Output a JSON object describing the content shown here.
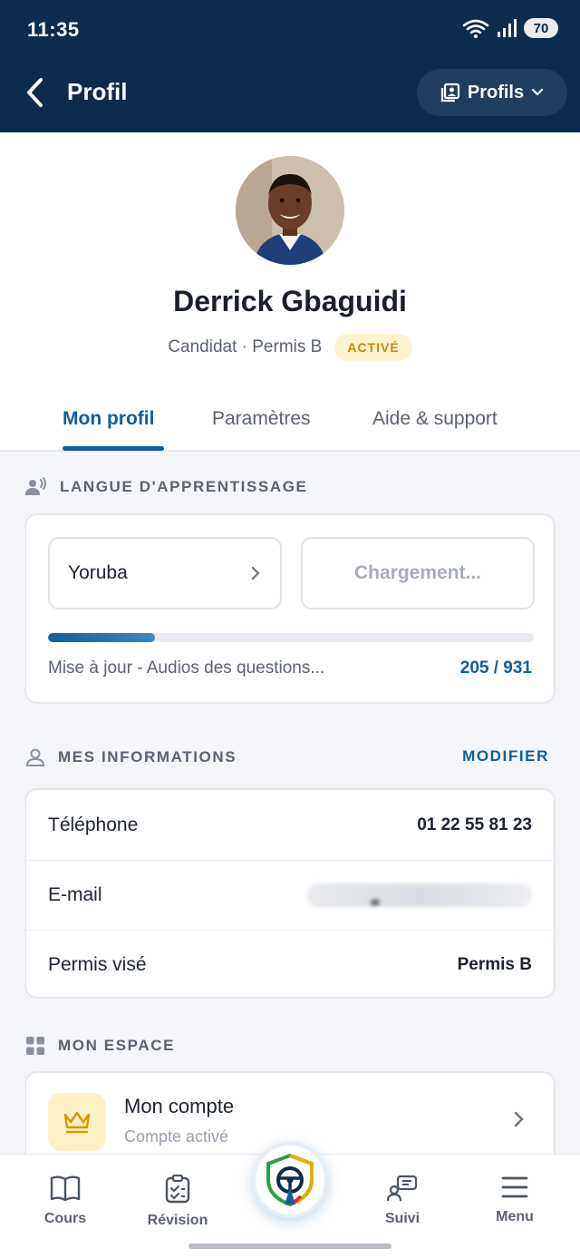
{
  "status_bar": {
    "time": "11:35",
    "battery": "70"
  },
  "header": {
    "title": "Profil",
    "profils_button": "Profils"
  },
  "profile": {
    "name": "Derrick Gbaguidi",
    "role": "Candidat · Permis B",
    "status_badge": "ACTIVÉ"
  },
  "tabs": [
    "Mon profil",
    "Paramètres",
    "Aide & support"
  ],
  "language_section": {
    "title": "LANGUE D'APPRENTISSAGE",
    "selected_language": "Yoruba",
    "loading_label": "Chargement...",
    "progress_label": "Mise à jour - Audios des questions...",
    "progress_done": 205,
    "progress_total": 931,
    "progress_text": "205 / 931"
  },
  "info_section": {
    "title": "MES INFORMATIONS",
    "action": "MODIFIER",
    "rows": [
      {
        "label": "Téléphone",
        "value": "01 22 55 81 23"
      },
      {
        "label": "E-mail",
        "value": ""
      },
      {
        "label": "Permis visé",
        "value": "Permis B"
      }
    ]
  },
  "space_section": {
    "title": "MON ESPACE",
    "account_title": "Mon compte",
    "account_subtitle": "Compte activé"
  },
  "bottom_nav": {
    "items": [
      "Cours",
      "Révision",
      "Suivi",
      "Menu"
    ]
  },
  "colors": {
    "header": "#0b2b4f",
    "accent": "#0f5fa0",
    "badge_bg": "#fff4cf",
    "badge_text": "#c98a00"
  }
}
